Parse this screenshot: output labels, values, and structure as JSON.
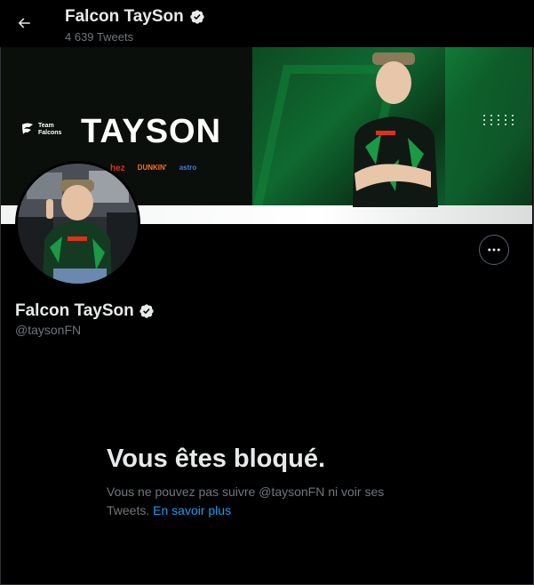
{
  "header": {
    "title": "Falcon TaySon",
    "tweet_count": "4 639 Tweets"
  },
  "banner": {
    "team_logo_text": [
      "Team",
      "Falcons"
    ],
    "player_name": "TAYSON",
    "sponsors": [
      "hez",
      "DUNKIN'",
      "astro"
    ]
  },
  "profile": {
    "display_name": "Falcon TaySon",
    "handle": "@taysonFN",
    "verified": true
  },
  "blocked": {
    "title": "Vous êtes bloqué.",
    "message": "Vous ne pouvez pas suivre @taysonFN ni voir ses Tweets.",
    "link": "En savoir plus"
  },
  "colors": {
    "background": "#000000",
    "text_primary": "#e7e9ea",
    "text_secondary": "#71767b",
    "link": "#1d9bf0",
    "verified": "#e7e9ea"
  },
  "icons": {
    "back": "arrow-left-icon",
    "verified": "verified-badge-icon",
    "more": "more-horizontal-icon"
  }
}
